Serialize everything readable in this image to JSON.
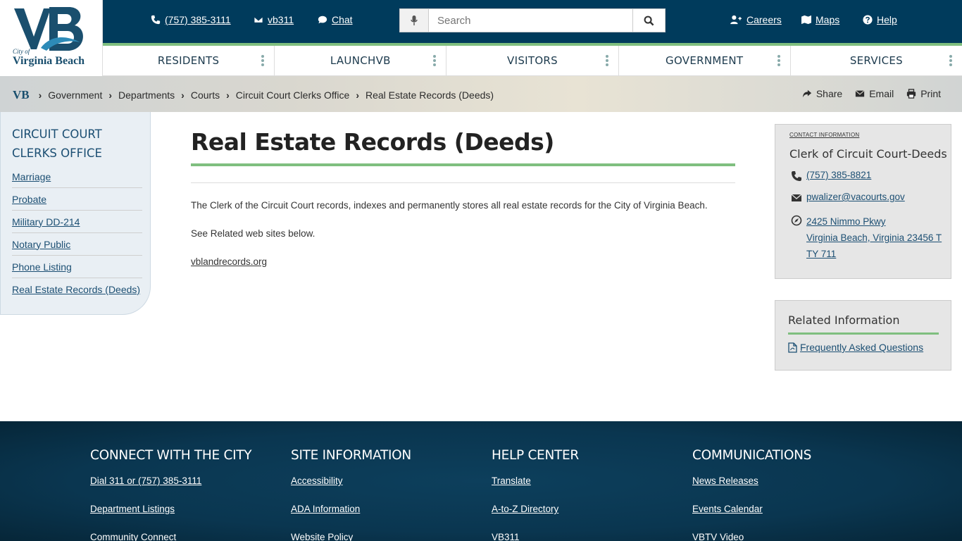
{
  "logo": {
    "city": "City of",
    "name": "Virginia Beach"
  },
  "topbar": {
    "phone": "(757) 385-3111",
    "vb311": "vb311",
    "chat": "Chat",
    "search_placeholder": "Search",
    "careers": "Careers",
    "maps": "Maps",
    "help": "Help"
  },
  "nav": [
    "RESIDENTS",
    "LAUNCHVB",
    "VISITORS",
    "GOVERNMENT",
    "SERVICES"
  ],
  "breadcrumb": {
    "home_logo": "VB",
    "items": [
      "Government",
      "Departments",
      "Courts",
      "Circuit Court Clerks Office",
      "Real Estate Records (Deeds)"
    ]
  },
  "tools": {
    "share": "Share",
    "email": "Email",
    "print": "Print"
  },
  "sidebar": {
    "title": "CIRCUIT COURT CLERKS OFFICE",
    "items": [
      "Marriage",
      "Probate",
      "Military DD-214",
      "Notary Public",
      "Phone Listing",
      "Real Estate Records (Deeds)"
    ]
  },
  "main": {
    "title": "Real Estate Records (Deeds)",
    "para1": "The Clerk of the Circuit Court records, indexes and permanently stores all real estate records for the City of Virginia Beach.",
    "para2": "See Related web sites below.",
    "link": "vblandrecords.org"
  },
  "contact": {
    "label": "CONTACT INFORMATION",
    "name": "Clerk of Circuit Court-Deeds",
    "phone": "(757) 385-8821",
    "email": "pwalizer@vacourts.gov",
    "address1": "2425 Nimmo Pkwy",
    "address2": "Virginia Beach, Virginia  23456 TTY 711"
  },
  "related": {
    "title": "Related Information",
    "link": "Frequently Asked Questions"
  },
  "footer": {
    "columns": [
      {
        "title": "CONNECT WITH THE CITY",
        "links": [
          "Dial 311 or (757) 385-3111",
          "Department Listings",
          "Community Connect"
        ]
      },
      {
        "title": "SITE INFORMATION",
        "links": [
          "Accessibility",
          "ADA Information",
          "Website Policy"
        ]
      },
      {
        "title": "HELP CENTER",
        "links": [
          "Translate",
          "A-to-Z Directory",
          "VB311"
        ]
      },
      {
        "title": "COMMUNICATIONS",
        "links": [
          "News Releases",
          "Events Calendar",
          "VBTV Video"
        ]
      }
    ]
  },
  "colors": {
    "header_navy": "#003b5c",
    "accent_green": "#7fbf7f",
    "link_blue": "#1c4f73",
    "footer_navy": "#0a3650"
  }
}
